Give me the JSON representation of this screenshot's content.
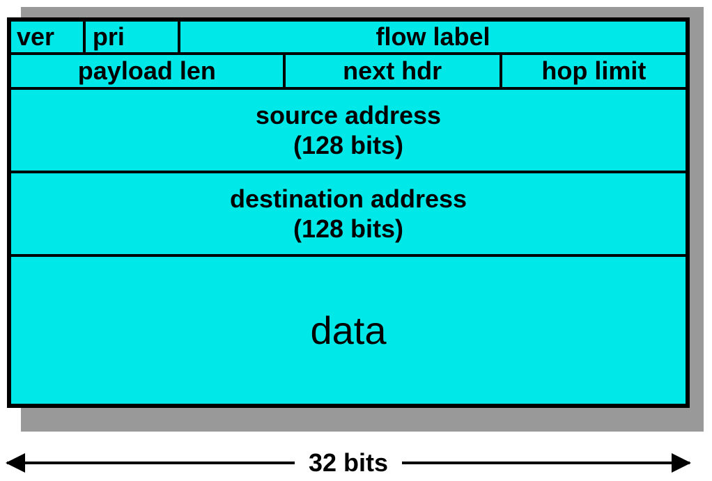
{
  "diagram": {
    "row1": {
      "ver": "ver",
      "pri": "pri",
      "flow_label": "flow label"
    },
    "row2": {
      "payload_len": "payload len",
      "next_hdr": "next hdr",
      "hop_limit": "hop limit"
    },
    "source_address": {
      "line1": "source address",
      "line2": "(128 bits)"
    },
    "destination_address": {
      "line1": "destination address",
      "line2": "(128 bits)"
    },
    "data": "data",
    "width_label": "32 bits"
  }
}
